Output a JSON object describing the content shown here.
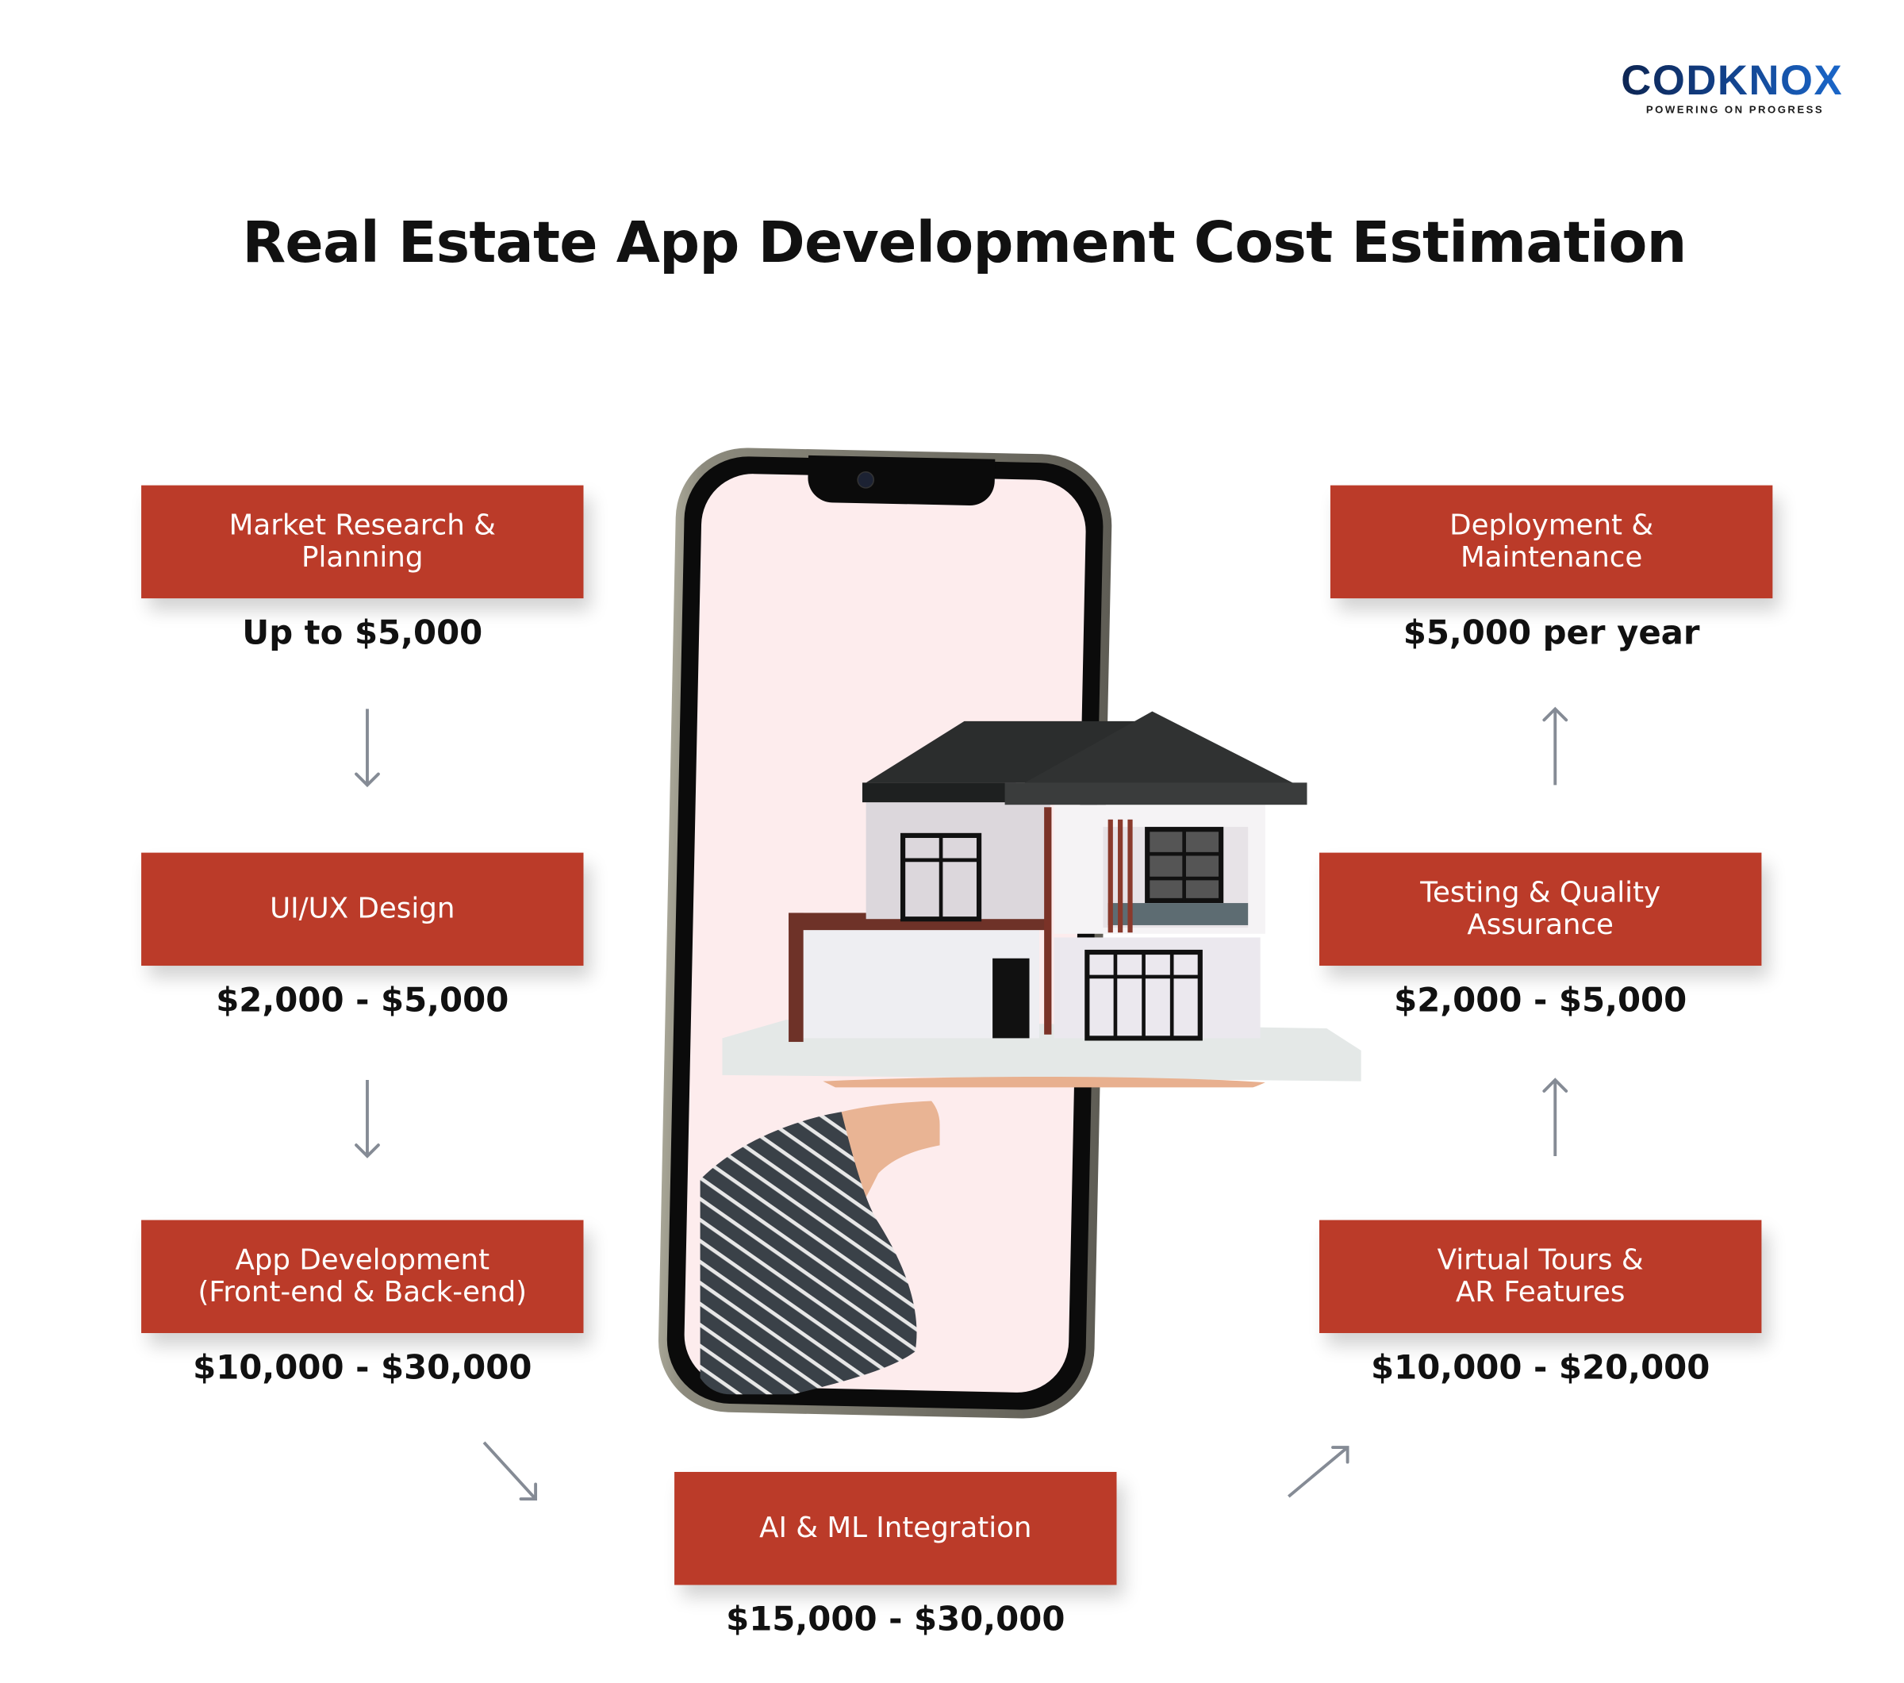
{
  "brand": {
    "logo_text": "CODKNOX",
    "tagline": "POWERING ON PROGRESS",
    "colors": {
      "logo_dark": "#0c1f46",
      "logo_light": "#1c6fd8"
    }
  },
  "title": "Real Estate App Development Cost Estimation",
  "theme": {
    "box_color": "#bb3b29",
    "box_text_color": "#ffffff",
    "arrow_color": "#858b95",
    "screen_color": "#fdeced"
  },
  "steps": [
    {
      "label": "Market Research &\nPlanning",
      "cost": "Up to $5,000"
    },
    {
      "label": "UI/UX Design",
      "cost": "$2,000 - $5,000"
    },
    {
      "label": "App Development\n(Front-end & Back-end)",
      "cost": "$10,000 - $30,000"
    },
    {
      "label": "AI & ML Integration",
      "cost": "$15,000 - $30,000"
    },
    {
      "label": "Virtual Tours &\nAR Features",
      "cost": "$10,000 - $20,000"
    },
    {
      "label": "Testing & Quality\nAssurance",
      "cost": "$2,000 - $5,000"
    },
    {
      "label": "Deployment &\nMaintenance",
      "cost": "$5,000 per year"
    }
  ],
  "illustration": {
    "description": "Smartphone with a hand emerging from the screen holding a model house"
  }
}
